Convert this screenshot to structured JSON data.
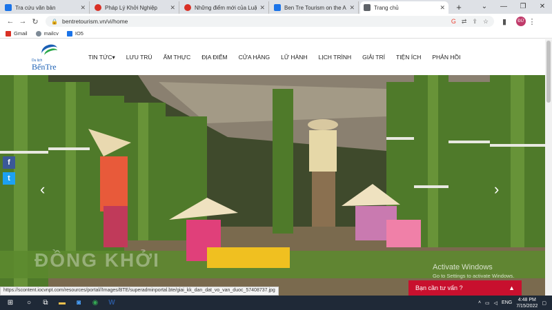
{
  "browser": {
    "tabs": [
      {
        "label": "Tra cứu văn bản",
        "icon_color": "#1a73e8"
      },
      {
        "label": "Pháp Lý Khởi Nghiệp",
        "icon_color": "#d93025"
      },
      {
        "label": "Những điểm mới của Luật S",
        "icon_color": "#d93025"
      },
      {
        "label": "Ben Tre Tourism on the App",
        "icon_color": "#1a73e8"
      },
      {
        "label": "Trang chủ",
        "icon_color": "#5f6368",
        "active": true
      }
    ],
    "new_tab": "+",
    "url": "bentretourism.vn/vi/home",
    "bookmarks": [
      {
        "label": "Gmail",
        "icon_color": "#d93025"
      },
      {
        "label": "mailcv",
        "icon_color": "#7d8a96"
      },
      {
        "label": "IO5",
        "icon_color": "#1a73e8"
      }
    ],
    "profile": "ĐỨ"
  },
  "site": {
    "logo_top": "Du lịch",
    "logo_bottom": "BếnTre",
    "menu": [
      "TIN TỨC▾",
      "LƯU TRÚ",
      "ẨM THỰC",
      "ĐỊA ĐIỂM",
      "CỬA HÀNG",
      "LỮ HÀNH",
      "LỊCH TRÌNH",
      "GIẢI TRÍ",
      "TIỆN ÍCH",
      "PHẢN HỒI"
    ],
    "hero_watermark": "ĐỒNG KHỞI",
    "consult_button": "Bạn cần tư vấn ?",
    "consult_caret": "▲",
    "status_url": "https://scontent.iocvnpt.com/resources/portal//Images/BTE/superadminportal.bte/giai_kk_dan_dat_vo_van_duoc_57408737.jpg"
  },
  "windows": {
    "activate_title": "Activate Windows",
    "activate_sub": "Go to Settings to activate Windows.",
    "lang": "ENG",
    "time": "4:48 PM",
    "date": "7/15/2022"
  }
}
